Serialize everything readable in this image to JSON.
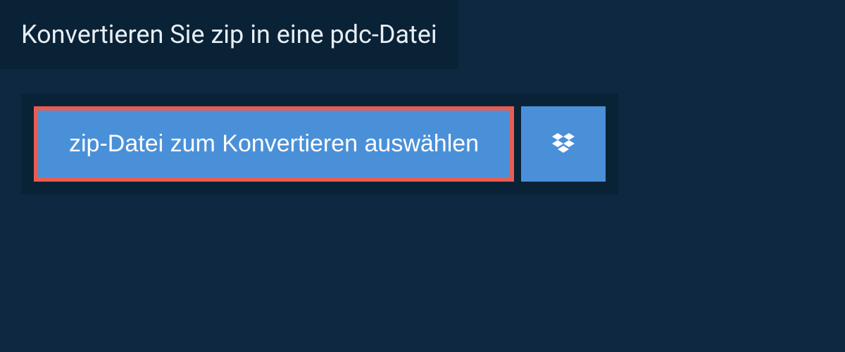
{
  "header": {
    "title": "Konvertieren Sie zip in eine pdc-Datei"
  },
  "upload": {
    "select_file_label": "zip-Datei zum Konvertieren auswählen",
    "dropbox_icon_name": "dropbox-icon"
  },
  "colors": {
    "background": "#0d2840",
    "panel": "#0a2236",
    "button_primary": "#4a90d9",
    "highlight_border": "#e85d52",
    "text_light": "#e8eef4",
    "text_on_primary": "#ffffff"
  }
}
